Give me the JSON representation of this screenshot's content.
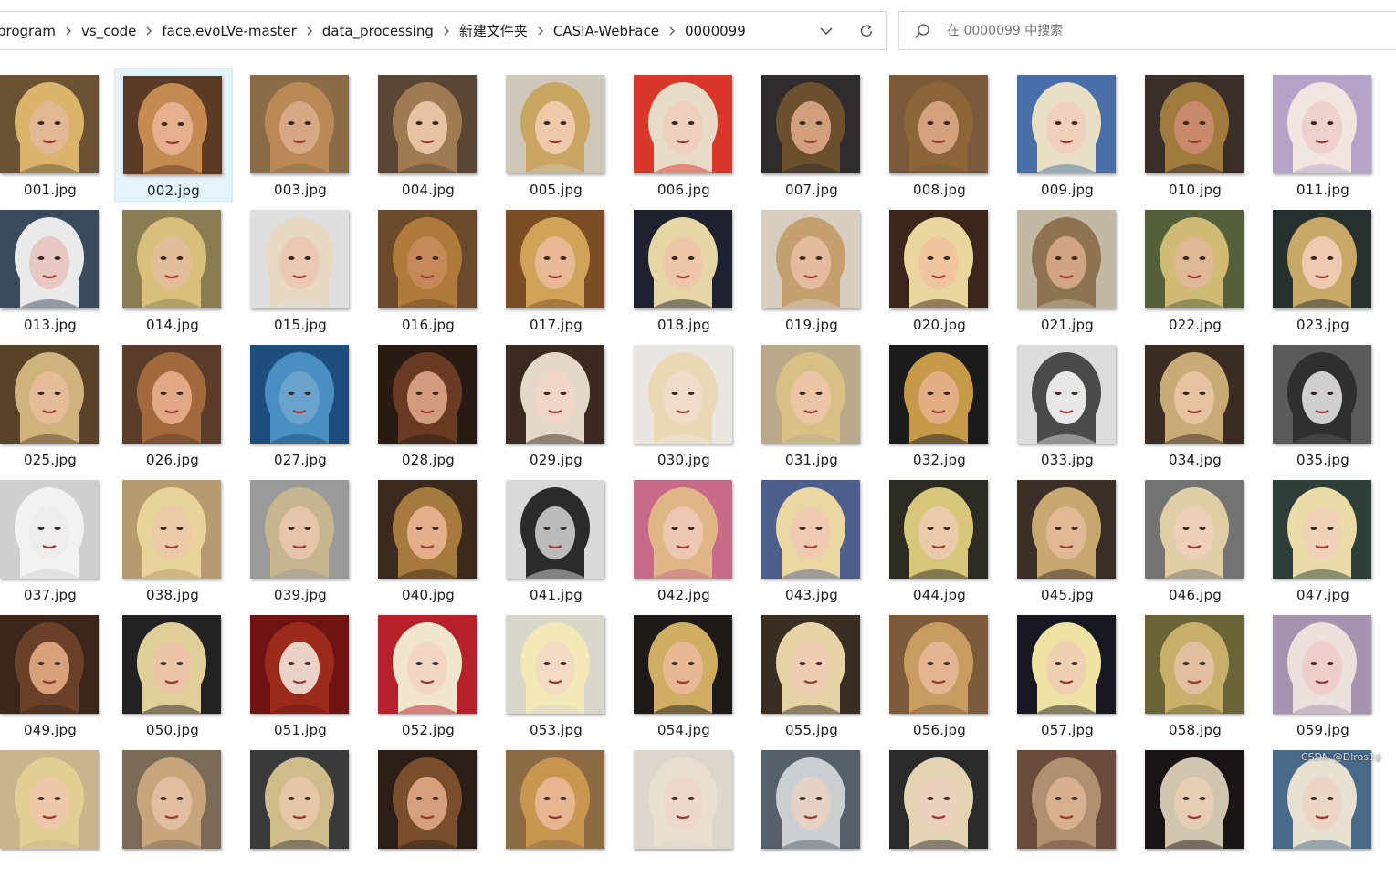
{
  "breadcrumb": {
    "items": [
      "program",
      "vs_code",
      "face.evoLVe-master",
      "data_processing",
      "新建文件夹",
      "CASIA-WebFace",
      "0000099"
    ]
  },
  "search": {
    "placeholder": "在 0000099 中搜索"
  },
  "icons": {
    "separator": "chevron-right-icon",
    "dropdown": "chevron-down-icon",
    "refresh": "refresh-icon",
    "search": "search-icon"
  },
  "files": {
    "selected": "002.jpg",
    "rows": [
      [
        "001.jpg",
        "002.jpg",
        "003.jpg",
        "004.jpg",
        "005.jpg",
        "006.jpg",
        "007.jpg",
        "008.jpg",
        "009.jpg",
        "010.jpg",
        "011.jpg"
      ],
      [
        "013.jpg",
        "014.jpg",
        "015.jpg",
        "016.jpg",
        "017.jpg",
        "018.jpg",
        "019.jpg",
        "020.jpg",
        "021.jpg",
        "022.jpg",
        "023.jpg"
      ],
      [
        "025.jpg",
        "026.jpg",
        "027.jpg",
        "028.jpg",
        "029.jpg",
        "030.jpg",
        "031.jpg",
        "032.jpg",
        "033.jpg",
        "034.jpg",
        "035.jpg"
      ],
      [
        "037.jpg",
        "038.jpg",
        "039.jpg",
        "040.jpg",
        "041.jpg",
        "042.jpg",
        "043.jpg",
        "044.jpg",
        "045.jpg",
        "046.jpg",
        "047.jpg"
      ],
      [
        "049.jpg",
        "050.jpg",
        "051.jpg",
        "052.jpg",
        "053.jpg",
        "054.jpg",
        "055.jpg",
        "056.jpg",
        "057.jpg",
        "058.jpg",
        "059.jpg"
      ],
      [
        "",
        "",
        "",
        "",
        "",
        "",
        "",
        "",
        "",
        "",
        ""
      ]
    ]
  },
  "thumb_palettes": [
    [
      "#6a5233",
      "#d9b46a",
      "#e2b894"
    ],
    [
      "#5b3a26",
      "#c58a52",
      "#e6b08f"
    ],
    [
      "#8b6a48",
      "#b98a55",
      "#d6a883"
    ],
    [
      "#5a4634",
      "#a07a52",
      "#e6c1a2"
    ],
    [
      "#cfc7b9",
      "#c9a562",
      "#f0c9aa"
    ],
    [
      "#d8372a",
      "#e8dcc8",
      "#efcfbd"
    ],
    [
      "#2f2c2b",
      "#6b4f2e",
      "#d19f7d"
    ],
    [
      "#7a5a3a",
      "#8c6538",
      "#d5a27e"
    ],
    [
      "#4a6fa8",
      "#e9dfc5",
      "#f1d1bd"
    ],
    [
      "#3a2f28",
      "#a07b3e",
      "#c88a6a"
    ],
    [
      "#b5a3c8",
      "#f1e6df",
      "#eed0cf"
    ],
    [
      "#3b4a5c",
      "#eaeaea",
      "#e8c8c2"
    ],
    [
      "#8a7d54",
      "#d8c07c",
      "#e2bd99"
    ],
    [
      "#dedede",
      "#e7d9c1",
      "#ecc9b5"
    ],
    [
      "#6a4a2a",
      "#b07a3a",
      "#c68a5a"
    ],
    [
      "#7c4d24",
      "#d0a458",
      "#e8b994"
    ],
    [
      "#1e2230",
      "#e7d6a6",
      "#eec7a9"
    ],
    [
      "#d8cec0",
      "#c4a070",
      "#e4bb9c"
    ],
    [
      "#3b2619",
      "#ead79f",
      "#f0c59e"
    ],
    [
      "#c2b9a4",
      "#8e7350",
      "#d1a483"
    ],
    [
      "#54603a",
      "#cfbb74",
      "#dfb995"
    ],
    [
      "#26302f",
      "#c9a867",
      "#efcab0"
    ],
    [
      "#5a4228",
      "#cfb27c",
      "#e6bb98"
    ],
    [
      "#5a3c2a",
      "#a26a3c",
      "#e2a885"
    ],
    [
      "#1c4d7e",
      "#4a8fc2",
      "#6aa3cc"
    ],
    [
      "#2a1a14",
      "#6a3a22",
      "#d29a7e"
    ],
    [
      "#3a2a22",
      "#e6d8c8",
      "#f0d6c4"
    ],
    [
      "#e9e6e1",
      "#e8d9b4",
      "#f0ddc9"
    ],
    [
      "#bba98c",
      "#d8c184",
      "#ebc5a6"
    ],
    [
      "#1b1b1b",
      "#c79a4a",
      "#e3ae84"
    ],
    [
      "#dcdcdc",
      "#4a4a4a",
      "#e7e7e7"
    ],
    [
      "#3a2c20",
      "#c9ab78",
      "#e7c2a0"
    ],
    [
      "#5a5a5a",
      "#2f2f2f",
      "#cfcfcf"
    ],
    [
      "#cfcfcf",
      "#f2f2f2",
      "#ededed"
    ],
    [
      "#b59b6e",
      "#e8d39a",
      "#ecc9a7"
    ],
    [
      "#9a9a9a",
      "#c6b58f",
      "#e6c5ab"
    ],
    [
      "#3c2a1c",
      "#a67a3e",
      "#e4b08c"
    ],
    [
      "#d9d9d9",
      "#2a2a2a",
      "#bbbbbb"
    ],
    [
      "#c86b8a",
      "#e1b686",
      "#edc7b4"
    ],
    [
      "#4d5f8c",
      "#ebd7a2",
      "#efcab0"
    ],
    [
      "#2b2b22",
      "#d8c67b",
      "#e9cba9"
    ],
    [
      "#3a2e26",
      "#c8a770",
      "#e1b994"
    ],
    [
      "#737373",
      "#e0cfa6",
      "#ecd0ba"
    ],
    [
      "#2d3f38",
      "#e9dca6",
      "#f0d2b8"
    ],
    [
      "#3b2619",
      "#6a4128",
      "#d9a07c"
    ],
    [
      "#222222",
      "#e0cf99",
      "#ecc5a7"
    ],
    [
      "#6f1412",
      "#9c2a1a",
      "#ead2c6"
    ],
    [
      "#b5202a",
      "#f1e6cc",
      "#f2d6c4"
    ],
    [
      "#d9d6cc",
      "#f2e9b6",
      "#f4dcc4"
    ],
    [
      "#1e1a18",
      "#cfae64",
      "#e8b894"
    ],
    [
      "#3a2d22",
      "#e5d3a5",
      "#efcdb2"
    ],
    [
      "#7c5a3a",
      "#c99c62",
      "#e4b38f"
    ],
    [
      "#181822",
      "#f0e2a2",
      "#f0d0b2"
    ],
    [
      "#6b6438",
      "#c9b06a",
      "#e2bf9e"
    ],
    [
      "#a593b0",
      "#ece0dc",
      "#efcdca"
    ],
    [
      "#c9b48c",
      "#e2ce92",
      "#ecc8a8"
    ],
    [
      "#7a6a56",
      "#c8a57a",
      "#e3bd9f"
    ],
    [
      "#3a3a3a",
      "#d0bc8a",
      "#e6c7a8"
    ],
    [
      "#2c1e16",
      "#7a4e2c",
      "#d6a07c"
    ],
    [
      "#8c6a44",
      "#c99650",
      "#e7b590"
    ],
    [
      "#ddd6cc",
      "#e8dfd0",
      "#eed8cc"
    ],
    [
      "#56606a",
      "#c9cfd2",
      "#e5d2c4"
    ],
    [
      "#2a2a2a",
      "#e4d4b4",
      "#ebd0bc"
    ],
    [
      "#6a4a3a",
      "#b09070",
      "#d8b090"
    ],
    [
      "#1a1414",
      "#d2c5b0",
      "#e6cdb6"
    ],
    [
      "#4a6a8a",
      "#e8e0d0",
      "#ecd5c5"
    ]
  ]
}
